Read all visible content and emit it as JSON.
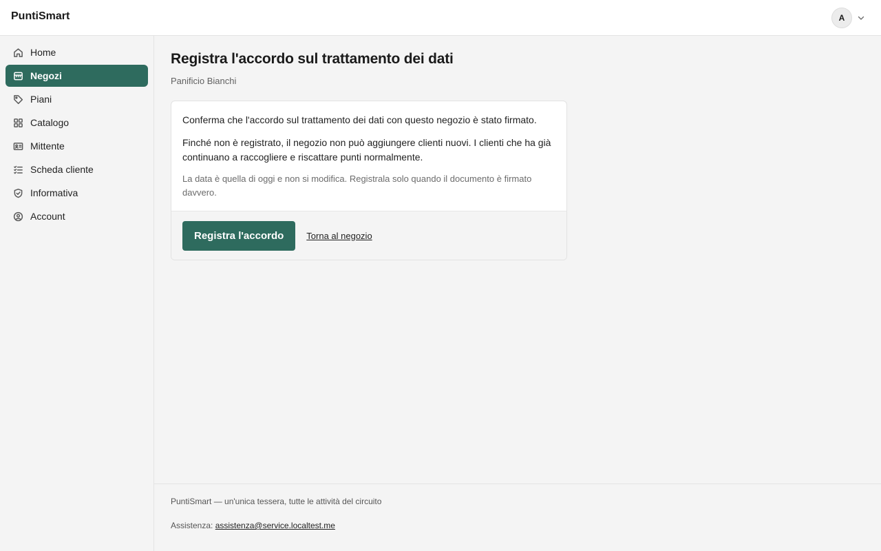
{
  "app": {
    "brand": "PuntiSmart"
  },
  "user": {
    "initial": "A",
    "menu_icon": "chevron-down-icon"
  },
  "sidebar": {
    "items": [
      {
        "label": "Home",
        "icon": "home-icon",
        "active": false
      },
      {
        "label": "Negozi",
        "icon": "store-icon",
        "active": true
      },
      {
        "label": "Piani",
        "icon": "tag-icon",
        "active": false
      },
      {
        "label": "Catalogo",
        "icon": "grid-icon",
        "active": false
      },
      {
        "label": "Mittente",
        "icon": "id-card-icon",
        "active": false
      },
      {
        "label": "Scheda cliente",
        "icon": "checklist-icon",
        "active": false
      },
      {
        "label": "Informativa",
        "icon": "shield-check-icon",
        "active": false
      },
      {
        "label": "Account",
        "icon": "user-circle-icon",
        "active": false
      }
    ]
  },
  "page": {
    "title": "Registra l'accordo sul trattamento dei dati",
    "subtitle": "Panificio Bianchi"
  },
  "card": {
    "paragraph_1": "Conferma che l'accordo sul trattamento dei dati con questo negozio è stato firmato.",
    "paragraph_2": "Finché non è registrato, il negozio non può aggiungere clienti nuovi. I clienti che ha già continuano a raccogliere e riscattare punti normalmente.",
    "note": "La data è quella di oggi e non si modifica. Registrala solo quando il documento è firmato davvero.",
    "primary_button": "Registra l'accordo",
    "back_link": "Torna al negozio"
  },
  "footer": {
    "tagline": "PuntiSmart — un'unica tessera, tutte le attività del circuito",
    "assist_label": "Assistenza:",
    "assist_email": "assistenza@service.localtest.me"
  },
  "colors": {
    "accent": "#2e6b5e",
    "background": "#f4f4f4",
    "surface": "#ffffff"
  }
}
